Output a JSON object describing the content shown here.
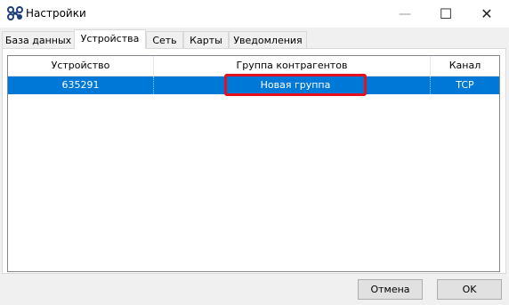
{
  "window": {
    "title": "Настройки",
    "app_icon": "app-logo-icon",
    "controls": {
      "minimize": "—",
      "maximize": "☐",
      "close": "✕"
    }
  },
  "tabs": [
    {
      "label": "База данных",
      "active": false
    },
    {
      "label": "Устройства",
      "active": true
    },
    {
      "label": "Сеть",
      "active": false
    },
    {
      "label": "Карты",
      "active": false
    },
    {
      "label": "Уведомления",
      "active": false
    }
  ],
  "devices_table": {
    "columns": [
      "Устройство",
      "Группа контрагентов",
      "Канал"
    ],
    "rows": [
      {
        "device": "635291",
        "group": "Новая группа",
        "channel": "TCP",
        "selected": true
      }
    ]
  },
  "buttons": {
    "cancel": "Отмена",
    "ok": "OK"
  },
  "colors": {
    "selection": "#0078d7",
    "highlight_border": "#e3101d"
  }
}
